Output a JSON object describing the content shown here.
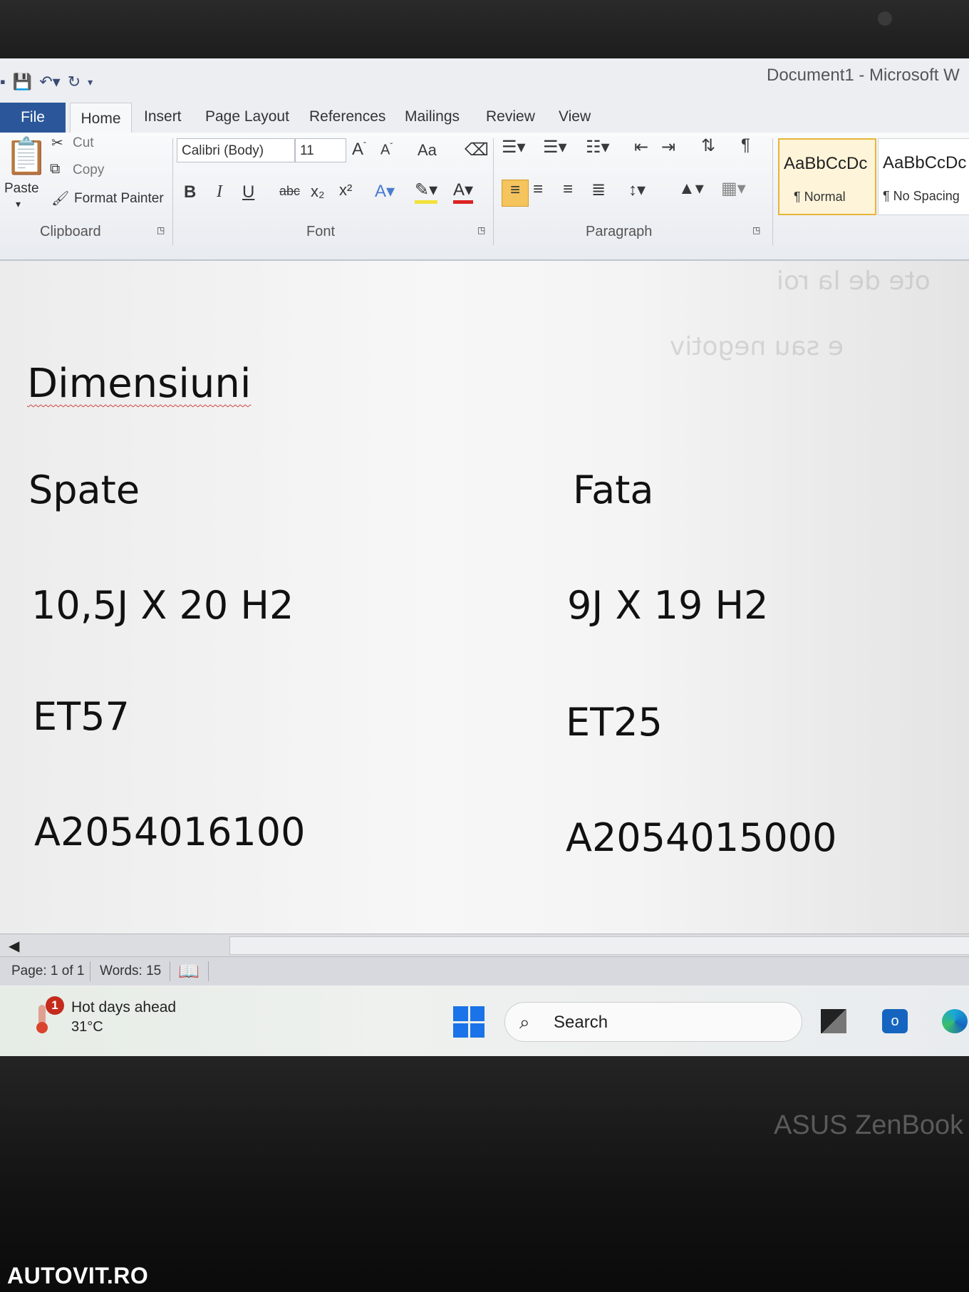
{
  "window": {
    "title": "Document1 - Microsoft W"
  },
  "tabs": [
    "File",
    "Home",
    "Insert",
    "Page Layout",
    "References",
    "Mailings",
    "Review",
    "View"
  ],
  "clipboard": {
    "paste": "Paste",
    "cut": "Cut",
    "copy": "Copy",
    "format_painter": "Format Painter",
    "label": "Clipboard"
  },
  "font": {
    "name": "Calibri (Body)",
    "size": "11",
    "label": "Font",
    "change_case": "Aa",
    "bold": "B",
    "italic": "I",
    "underline": "U",
    "strike": "abc"
  },
  "paragraph": {
    "label": "Paragraph"
  },
  "styles": [
    {
      "sample": "AaBbCcDc",
      "name": "¶ Normal"
    },
    {
      "sample": "AaBbCcDc",
      "name": "¶ No Spacing"
    }
  ],
  "document": {
    "heading": "Dimensiuni",
    "columns": [
      {
        "title": "Spate",
        "size": "10,5J X 20 H2",
        "offset": "ET57",
        "part": "A2054016100"
      },
      {
        "title": "Fata",
        "size": "9J X 19 H2",
        "offset": "ET25",
        "part": "A2054015000"
      }
    ]
  },
  "status": {
    "page": "Page: 1 of 1",
    "words": "Words: 15"
  },
  "taskbar": {
    "weather_title": "Hot days ahead",
    "weather_temp": "31°C",
    "weather_badge": "1",
    "search_label": "Search"
  },
  "laptop": {
    "brand": "ASUS ZenBook"
  },
  "watermark": "AUTOVIT.RO",
  "colors": {
    "file_tab": "#2b579a",
    "active_style": "#e6b53a",
    "windows_blue": "#1a73e8"
  }
}
